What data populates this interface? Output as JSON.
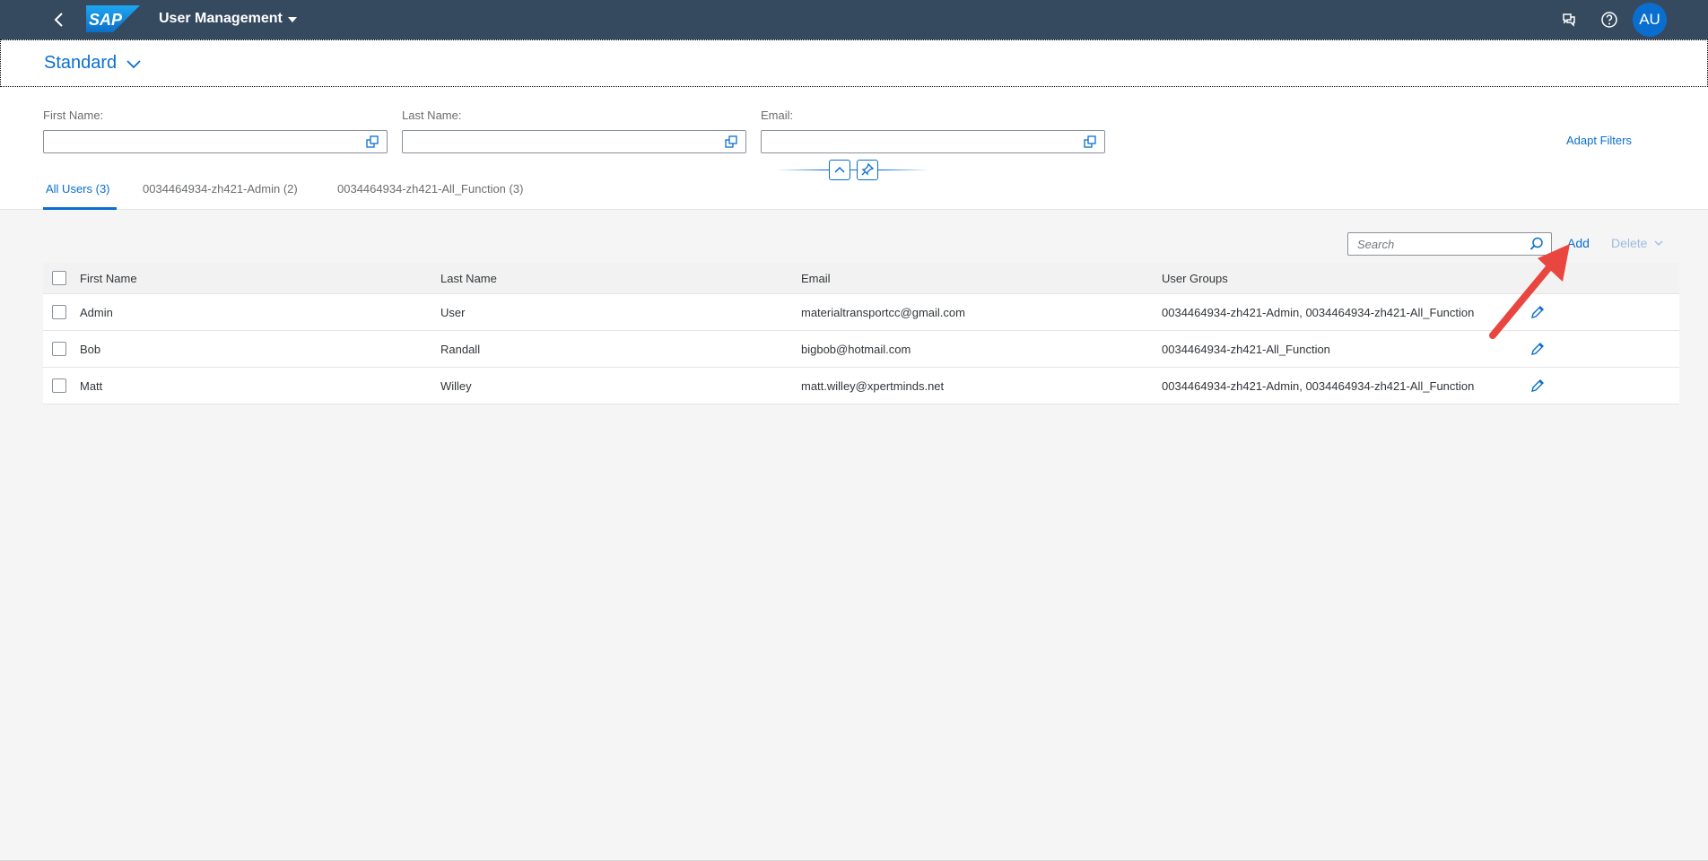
{
  "shell": {
    "logo_text": "SAP",
    "app_title": "User Management",
    "avatar_initials": "AU",
    "icons": [
      "back-icon",
      "notifications-icon",
      "help-icon"
    ]
  },
  "variant": {
    "title": "Standard"
  },
  "filters": {
    "first_name_label": "First Name:",
    "last_name_label": "Last Name:",
    "email_label": "Email:",
    "first_name_value": "",
    "last_name_value": "",
    "email_value": "",
    "adapt_filters": "Adapt Filters"
  },
  "tabs": [
    {
      "label": "All Users (3)"
    },
    {
      "label": "0034464934-zh421-Admin (2)"
    },
    {
      "label": "0034464934-zh421-All_Function (3)"
    }
  ],
  "toolbar": {
    "search_placeholder": "Search",
    "add_label": "Add",
    "delete_label": "Delete"
  },
  "table": {
    "columns": [
      "First Name",
      "Last Name",
      "Email",
      "User Groups"
    ],
    "rows": [
      {
        "first": "Admin",
        "last": "User",
        "email": "materialtransportcc@gmail.com",
        "groups": "0034464934-zh421-Admin, 0034464934-zh421-All_Function"
      },
      {
        "first": "Bob",
        "last": "Randall",
        "email": "bigbob@hotmail.com",
        "groups": "0034464934-zh421-All_Function"
      },
      {
        "first": "Matt",
        "last": "Willey",
        "email": "matt.willey@xpertminds.net",
        "groups": "0034464934-zh421-Admin, 0034464934-zh421-All_Function"
      }
    ]
  },
  "colors": {
    "shell_bg": "#354a5f",
    "accent": "#0a6ed1",
    "annotation_arrow": "#e8463f"
  }
}
